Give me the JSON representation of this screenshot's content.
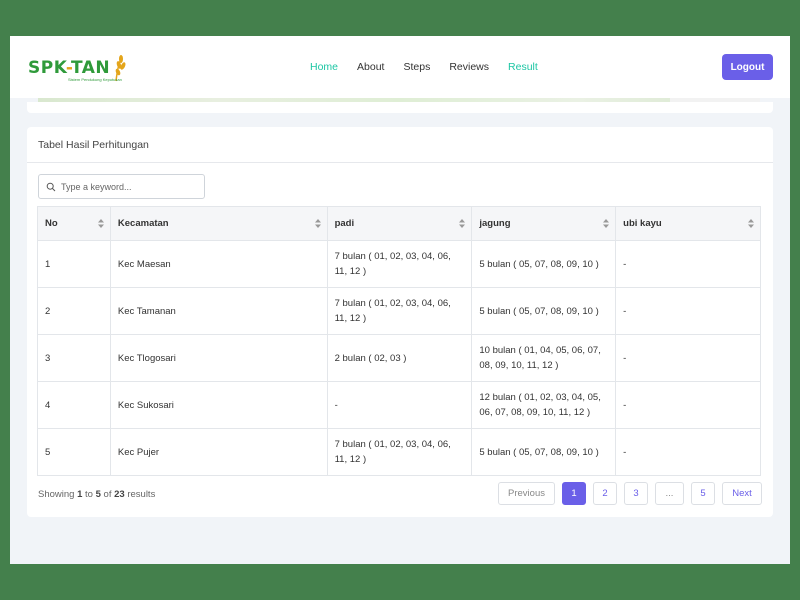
{
  "navbar": {
    "logo_text_left": "SPK",
    "logo_text_dash": "-",
    "logo_text_right": "TAN",
    "logo_subtext": "Sistem Pendukung Keputusan",
    "items": [
      {
        "label": "Home",
        "active": true
      },
      {
        "label": "About",
        "active": false
      },
      {
        "label": "Steps",
        "active": false
      },
      {
        "label": "Reviews",
        "active": false
      },
      {
        "label": "Result",
        "active": true
      }
    ],
    "logout_label": "Logout"
  },
  "card": {
    "title": "Tabel Hasil Perhitungan",
    "search_placeholder": "Type a keyword..."
  },
  "table": {
    "columns": [
      "No",
      "Kecamatan",
      "padi",
      "jagung",
      "ubi kayu"
    ],
    "rows": [
      {
        "no": "1",
        "kecamatan": "Kec Maesan",
        "padi": "7 bulan ( 01, 02, 03, 04, 06, 11, 12 )",
        "jagung": "5 bulan ( 05, 07, 08, 09, 10 )",
        "ubi_kayu": "-"
      },
      {
        "no": "2",
        "kecamatan": "Kec Tamanan",
        "padi": "7 bulan ( 01, 02, 03, 04, 06, 11, 12 )",
        "jagung": "5 bulan ( 05, 07, 08, 09, 10 )",
        "ubi_kayu": "-"
      },
      {
        "no": "3",
        "kecamatan": "Kec Tlogosari",
        "padi": "2 bulan ( 02, 03 )",
        "jagung": "10 bulan ( 01, 04, 05, 06, 07, 08, 09, 10, 11, 12 )",
        "ubi_kayu": "-"
      },
      {
        "no": "4",
        "kecamatan": "Kec Sukosari",
        "padi": "-",
        "jagung": "12 bulan ( 01, 02, 03, 04, 05, 06, 07, 08, 09, 10, 11, 12 )",
        "ubi_kayu": "-"
      },
      {
        "no": "5",
        "kecamatan": "Kec Pujer",
        "padi": "7 bulan ( 01, 02, 03, 04, 06, 11, 12 )",
        "jagung": "5 bulan ( 05, 07, 08, 09, 10 )",
        "ubi_kayu": "-"
      }
    ]
  },
  "footer": {
    "showing": "Showing",
    "from": "1",
    "to_word": "to",
    "to": "5",
    "of_word": "of",
    "total": "23",
    "results": "results"
  },
  "pagination": {
    "previous": "Previous",
    "pages": [
      "1",
      "2",
      "3"
    ],
    "ellipsis": "...",
    "last": "5",
    "next": "Next"
  },
  "colors": {
    "accent": "#6a5fe8",
    "nav_active": "#1cc6a4",
    "background": "#44804c"
  }
}
